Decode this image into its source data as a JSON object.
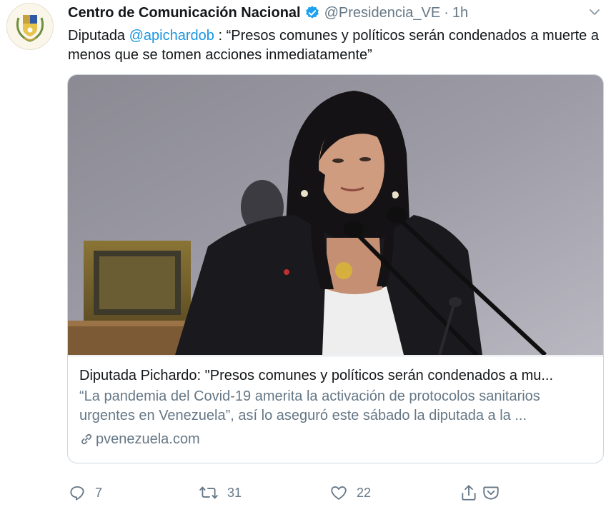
{
  "tweet": {
    "author_name": "Centro de Comunicación Nacional",
    "handle": "@Presidencia_VE",
    "separator": "·",
    "time": "1h",
    "text_prefix": "Diputada ",
    "mention": "@apichardob",
    "text_suffix": " : “Presos comunes y políticos serán condenados a muerte a menos que se tomen acciones inmediatamente”"
  },
  "card": {
    "title": "Diputada Pichardo: \"Presos comunes y políticos serán condenados a mu...",
    "description": "“La pandemia del Covid-19 amerita la activación de protocolos sanitarios urgentes en Venezuela”, así lo aseguró este sábado la diputada a la ...",
    "domain": "pvenezuela.com"
  },
  "actions": {
    "reply_count": "7",
    "retweet_count": "31",
    "like_count": "22"
  },
  "icons": {
    "verified": "verified-badge-icon",
    "more": "chevron-down-icon",
    "link": "link-icon",
    "reply": "reply-icon",
    "retweet": "retweet-icon",
    "like": "heart-icon",
    "share": "share-icon",
    "pocket": "pocket-icon"
  },
  "colors": {
    "link_blue": "#1b95e0",
    "verified_blue": "#1da1f2",
    "muted_gray": "#657786",
    "border": "#ccd6dd"
  }
}
